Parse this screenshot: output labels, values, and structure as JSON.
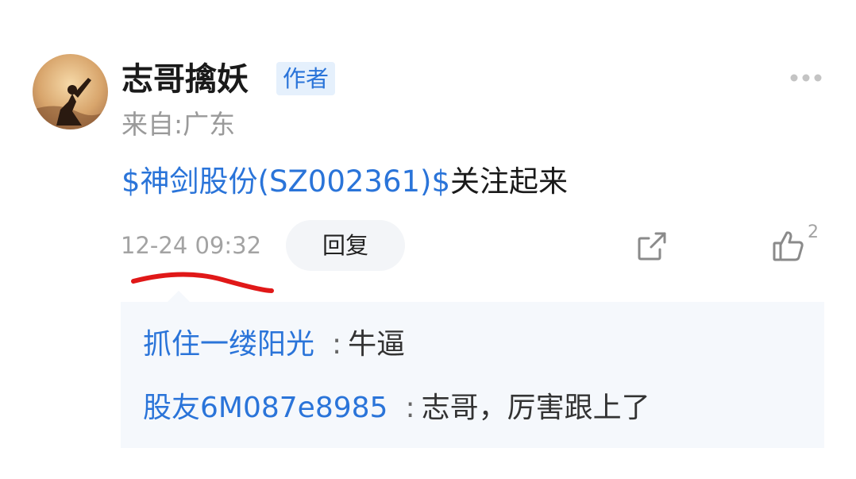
{
  "post": {
    "author": {
      "name": "志哥擒妖",
      "badge": "作者",
      "location": "来自:广东"
    },
    "content": {
      "stock_tag": "$神剑股份(SZ002361)$",
      "text": "关注起来"
    },
    "timestamp": "12-24 09:32",
    "actions": {
      "reply_label": "回复",
      "like_count": "2"
    }
  },
  "replies": [
    {
      "user": "抓住一缕阳光",
      "separator": ":",
      "text": "牛逼"
    },
    {
      "user": "股友6M087e8985",
      "separator": ":",
      "text": "志哥，厉害跟上了"
    }
  ],
  "colors": {
    "link": "#2a74d9",
    "muted": "#9a9a9a",
    "annotation": "#e01818",
    "reply_bg": "#f5f8fc"
  },
  "icons": [
    "avatar-image",
    "more-icon",
    "share-icon",
    "thumbs-up-icon"
  ]
}
